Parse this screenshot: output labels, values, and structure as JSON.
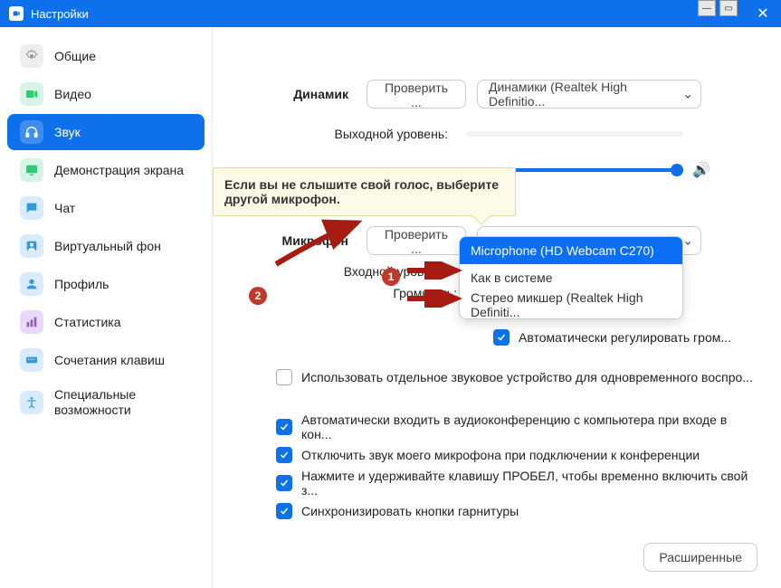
{
  "window": {
    "title": "Настройки"
  },
  "sidebar": {
    "items": [
      {
        "label": "Общие"
      },
      {
        "label": "Видео"
      },
      {
        "label": "Звук"
      },
      {
        "label": "Демонстрация экрана"
      },
      {
        "label": "Чат"
      },
      {
        "label": "Виртуальный фон"
      },
      {
        "label": "Профиль"
      },
      {
        "label": "Статистика"
      },
      {
        "label": "Сочетания клавиш"
      },
      {
        "label": "Специальные возможности"
      }
    ]
  },
  "speaker": {
    "label": "Динамик",
    "test_button": "Проверить ...",
    "device": "Динамики (Realtek High Definitio...",
    "output_level": "Выходной уровень:"
  },
  "tooltip": "Если вы не слышите свой голос, выберите другой микрофон.",
  "microphone": {
    "label": "Микрофон",
    "test_button": "Проверить ...",
    "device": "Microphone (HD Webcam C270)",
    "input_level": "Входной уровень:",
    "volume": "Громкость:",
    "options": [
      "Microphone (HD Webcam C270)",
      "Как в системе",
      "Стерео микшер (Realtek High Definiti..."
    ],
    "auto_adjust": "Автоматически регулировать гром..."
  },
  "checkboxes": {
    "separate_device": "Использовать отдельное звуковое устройство для одновременного воспро...",
    "auto_join": "Автоматически входить в аудиоконференцию с компьютера при входе в кон...",
    "mute_on_join": "Отключить звук моего микрофона при подключении к конференции",
    "push_to_talk": "Нажмите и удерживайте клавишу ПРОБЕЛ, чтобы временно включить свой з...",
    "sync_headset": "Синхронизировать кнопки гарнитуры"
  },
  "annotations": {
    "badge1": "1",
    "badge2": "2"
  },
  "footer": {
    "advanced": "Расширенные"
  }
}
